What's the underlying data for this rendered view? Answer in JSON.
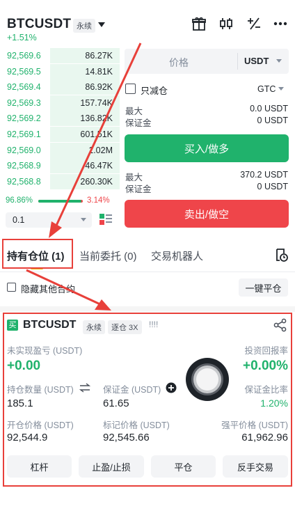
{
  "header": {
    "symbol": "BTCUSDT",
    "contract_type": "永续",
    "change": "+1.51%"
  },
  "orderbook": [
    {
      "price": "92,569.6",
      "qty": "86.27K",
      "depth": 0.58
    },
    {
      "price": "92,569.5",
      "qty": "14.81K",
      "depth": 0.58
    },
    {
      "price": "92,569.4",
      "qty": "86.92K",
      "depth": 0.58
    },
    {
      "price": "92,569.3",
      "qty": "157.74K",
      "depth": 0.58
    },
    {
      "price": "92,569.2",
      "qty": "136.82K",
      "depth": 0.58
    },
    {
      "price": "92,569.1",
      "qty": "601.51K",
      "depth": 0.58
    },
    {
      "price": "92,569.0",
      "qty": "1.02M",
      "depth": 0.58
    },
    {
      "price": "92,568.9",
      "qty": "46.47K",
      "depth": 0.58
    },
    {
      "price": "92,568.8",
      "qty": "260.30K",
      "depth": 0.58
    }
  ],
  "ratio": {
    "buy": "96.86%",
    "sell": "3.14%",
    "buy_fraction": 0.9686
  },
  "depth_select": "0.1",
  "order_form": {
    "price_placeholder": "价格",
    "unit": "USDT",
    "reduce_only": "只减仓",
    "tif": "GTC",
    "buy": {
      "max_label": "最大",
      "max_value": "0.0 USDT",
      "margin_label": "保证金",
      "margin_value": "0 USDT",
      "button": "买入/做多"
    },
    "sell": {
      "max_label": "最大",
      "max_value": "370.2 USDT",
      "margin_label": "保证金",
      "margin_value": "0 USDT",
      "button": "卖出/做空"
    }
  },
  "tabs": [
    {
      "label": "持有仓位 (1)",
      "active": true
    },
    {
      "label": "当前委托 (0)",
      "active": false
    },
    {
      "label": "交易机器人",
      "active": false
    }
  ],
  "hide_other": "隐藏其他合约",
  "close_all": "一键平仓",
  "position": {
    "side_badge": "买",
    "symbol": "BTCUSDT",
    "contract_type": "永续",
    "margin_mode": "逐仓 3X",
    "signal": "!!!!",
    "upnl_label": "未实现盈亏 (USDT)",
    "upnl_value": "+0.00",
    "roi_label": "投资回报率",
    "roi_value": "+0.00%",
    "size_label": "持仓数量 (USDT)",
    "size_value": "185.1",
    "margin_label": "保证金 (USDT)",
    "margin_value": "61.65",
    "margin_ratio_label": "保证金比率",
    "margin_ratio_value": "1.20%",
    "entry_label": "开仓价格 (USDT)",
    "entry_value": "92,544.9",
    "mark_label": "标记价格 (USDT)",
    "mark_value": "92,545.66",
    "liq_label": "强平价格 (USDT)",
    "liq_value": "61,962.96",
    "buttons": [
      "杠杆",
      "止盈/止损",
      "平仓",
      "反手交易"
    ]
  },
  "colors": {
    "green": "#20b26c",
    "red": "#ef454a",
    "annotation": "#e8403a"
  }
}
